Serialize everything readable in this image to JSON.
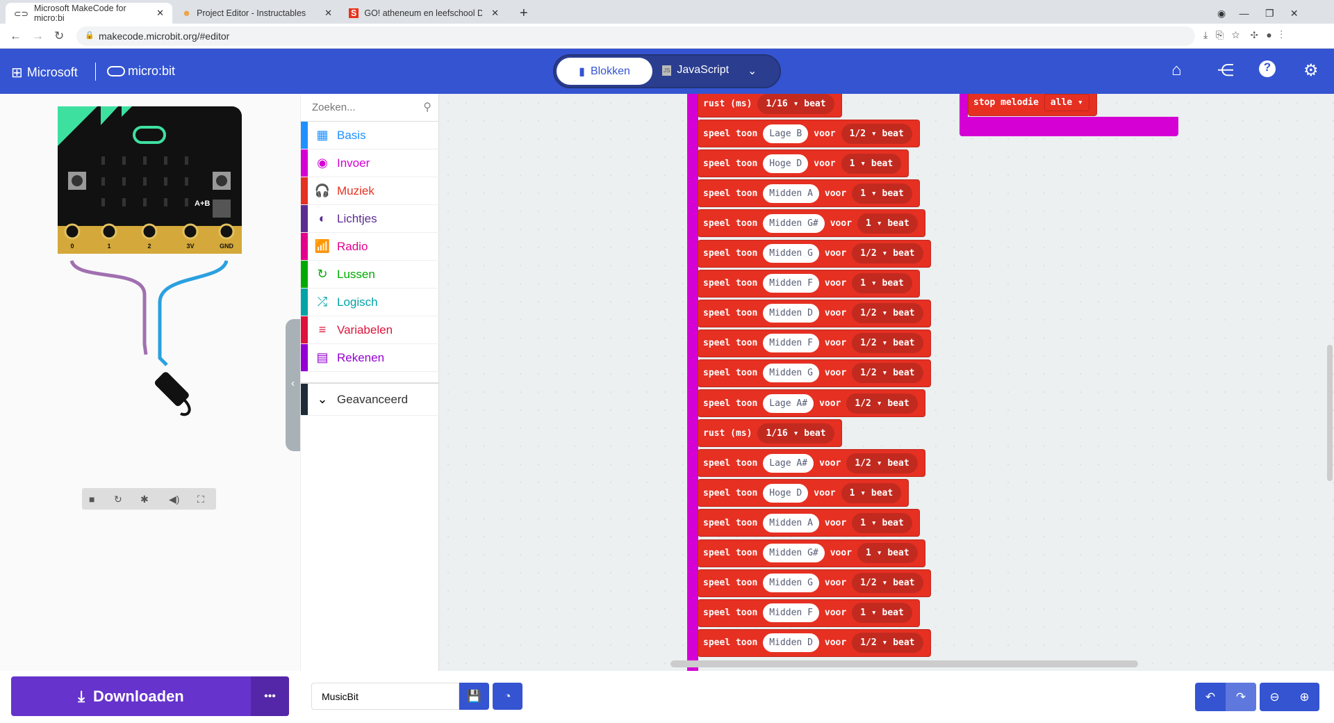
{
  "browser": {
    "tabs": [
      {
        "title": "Microsoft MakeCode for micro:bi",
        "icon": "makecode-icon"
      },
      {
        "title": "Project Editor - Instructables",
        "icon": "instructables-icon"
      },
      {
        "title": "GO! atheneum en leefschool De ",
        "icon": "s-icon"
      }
    ],
    "new_tab": "+",
    "url": "makecode.microbit.org/#editor"
  },
  "header": {
    "brand": "Microsoft",
    "product": "micro:bit",
    "blocks_tab": "Blokken",
    "js_tab": "JavaScript"
  },
  "toolbox": {
    "search_placeholder": "Zoeken...",
    "items": [
      {
        "label": "Basis",
        "color": "#1e90ff",
        "icon": "▦"
      },
      {
        "label": "Invoer",
        "color": "#d400d4",
        "icon": "◉"
      },
      {
        "label": "Muziek",
        "color": "#e63022",
        "icon": "🎧"
      },
      {
        "label": "Lichtjes",
        "color": "#5c2d91",
        "icon": "◐"
      },
      {
        "label": "Radio",
        "color": "#e3008c",
        "icon": "📶"
      },
      {
        "label": "Lussen",
        "color": "#00aa00",
        "icon": "↻"
      },
      {
        "label": "Logisch",
        "color": "#00a4a6",
        "icon": "⤮"
      },
      {
        "label": "Variabelen",
        "color": "#dc143c",
        "icon": "≡"
      },
      {
        "label": "Rekenen",
        "color": "#9400d3",
        "icon": "▤"
      }
    ],
    "advanced": "Geavanceerd"
  },
  "simulator": {
    "pins": [
      "0",
      "1",
      "2",
      "3V",
      "GND"
    ],
    "buttons": {
      "a": "A",
      "b": "B",
      "ab": "A+B"
    }
  },
  "blocks": {
    "play": "speel toon",
    "for": "voor",
    "beat": "beat",
    "rest": "rust (ms)",
    "rows": [
      {
        "type": "rest",
        "dur": "1/16"
      },
      {
        "type": "play",
        "note": "Lage B",
        "dur": "1/2"
      },
      {
        "type": "play",
        "note": "Hoge D",
        "dur": "1"
      },
      {
        "type": "play",
        "note": "Midden A",
        "dur": "1"
      },
      {
        "type": "play",
        "note": "Midden G#",
        "dur": "1"
      },
      {
        "type": "play",
        "note": "Midden G",
        "dur": "1/2"
      },
      {
        "type": "play",
        "note": "Midden F",
        "dur": "1"
      },
      {
        "type": "play",
        "note": "Midden D",
        "dur": "1/2"
      },
      {
        "type": "play",
        "note": "Midden F",
        "dur": "1/2"
      },
      {
        "type": "play",
        "note": "Midden G",
        "dur": "1/2"
      },
      {
        "type": "play",
        "note": "Lage A#",
        "dur": "1/2"
      },
      {
        "type": "rest",
        "dur": "1/16"
      },
      {
        "type": "play",
        "note": "Lage A#",
        "dur": "1/2"
      },
      {
        "type": "play",
        "note": "Hoge D",
        "dur": "1"
      },
      {
        "type": "play",
        "note": "Midden A",
        "dur": "1"
      },
      {
        "type": "play",
        "note": "Midden G#",
        "dur": "1"
      },
      {
        "type": "play",
        "note": "Midden G",
        "dur": "1/2"
      },
      {
        "type": "play",
        "note": "Midden F",
        "dur": "1"
      },
      {
        "type": "play",
        "note": "Midden D",
        "dur": "1/2"
      }
    ],
    "stop": {
      "label": "stop melodie",
      "value": "alle"
    }
  },
  "footer": {
    "download": "Downloaden",
    "more": "•••",
    "project_name": "MusicBit"
  }
}
